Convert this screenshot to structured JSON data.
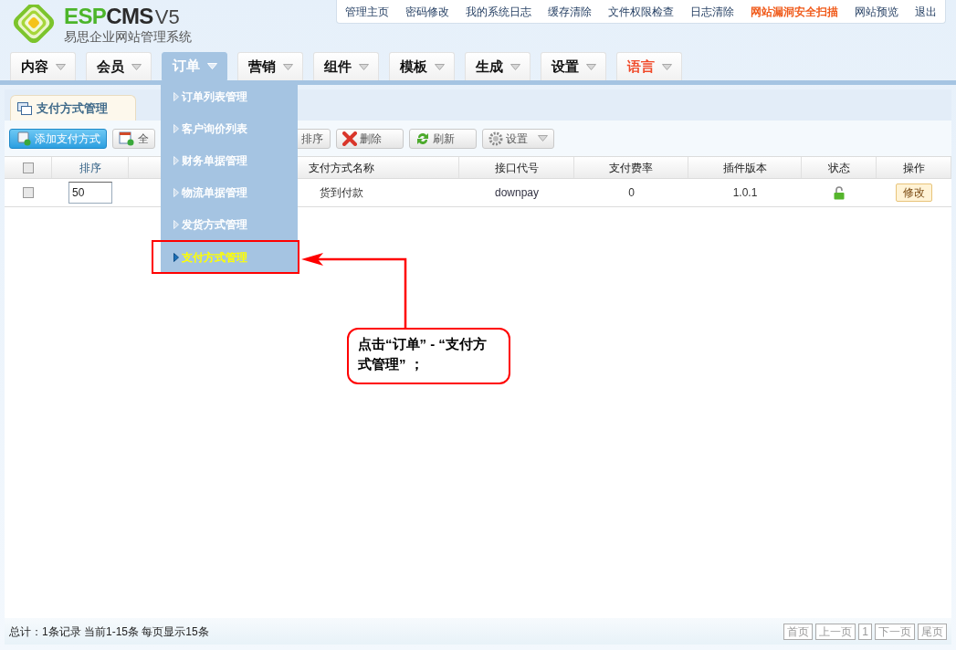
{
  "logo": {
    "brand_parts": [
      {
        "text": "ESP",
        "color": "#4cb52a"
      },
      {
        "text": "CMS",
        "color": "#2b2b2b"
      }
    ],
    "version": "V5",
    "subtitle": "易思企业网站管理系统"
  },
  "top_links": [
    {
      "label": "管理主页",
      "highlight": false
    },
    {
      "label": "密码修改",
      "highlight": false
    },
    {
      "label": "我的系统日志",
      "highlight": false
    },
    {
      "label": "缓存清除",
      "highlight": false
    },
    {
      "label": "文件权限检查",
      "highlight": false
    },
    {
      "label": "日志清除",
      "highlight": false
    },
    {
      "label": "网站漏洞安全扫描",
      "highlight": true
    },
    {
      "label": "网站预览",
      "highlight": false
    },
    {
      "label": "退出",
      "highlight": false
    }
  ],
  "nav_tabs": [
    {
      "label": "内容",
      "selected": false,
      "highlight": false
    },
    {
      "label": "会员",
      "selected": false,
      "highlight": false
    },
    {
      "label": "订单",
      "selected": true,
      "highlight": false
    },
    {
      "label": "营销",
      "selected": false,
      "highlight": false
    },
    {
      "label": "组件",
      "selected": false,
      "highlight": false
    },
    {
      "label": "模板",
      "selected": false,
      "highlight": false
    },
    {
      "label": "生成",
      "selected": false,
      "highlight": false
    },
    {
      "label": "设置",
      "selected": false,
      "highlight": false
    },
    {
      "label": "语言",
      "selected": false,
      "highlight": true
    }
  ],
  "dropdown": {
    "items": [
      {
        "label": "订单列表管理",
        "selected": false
      },
      {
        "label": "客户询价列表",
        "selected": false
      },
      {
        "label": "财务单据管理",
        "selected": false
      },
      {
        "label": "物流单据管理",
        "selected": false
      },
      {
        "label": "发货方式管理",
        "selected": false
      },
      {
        "label": "支付方式管理",
        "selected": true
      }
    ]
  },
  "page_tab": {
    "label": "支付方式管理"
  },
  "toolbar": [
    {
      "kind": "primary",
      "label": "添加支付方式"
    },
    {
      "kind": "select-all",
      "label": "全"
    },
    {
      "kind": "sort",
      "label": "排序"
    },
    {
      "kind": "delete",
      "label": "删除"
    },
    {
      "kind": "refresh",
      "label": "刷新"
    },
    {
      "kind": "settings",
      "label": "设置"
    }
  ],
  "table": {
    "header_checkbox": {
      "checked": false
    },
    "columns": [
      "排序",
      "支付方式名称",
      "接口代号",
      "支付费率",
      "插件版本",
      "状态",
      "操作"
    ],
    "rows": [
      {
        "checked": false,
        "order": "50",
        "name": "货到付款",
        "code": "downpay",
        "rate": "0",
        "version": "1.0.1",
        "unlocked": true,
        "action": "修改"
      }
    ]
  },
  "footer": {
    "summary": "总计：1条记录 当前1-15条 每页显示15条",
    "pager": [
      "首页",
      "上一页",
      "1",
      "下一页",
      "尾页"
    ]
  },
  "annotation": {
    "callout": "点击“订单” - “支付方式管理” ；"
  }
}
